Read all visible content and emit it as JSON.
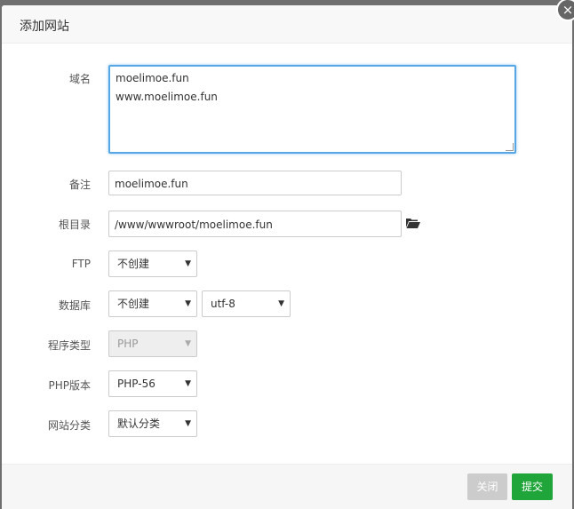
{
  "dialog": {
    "title": "添加网站",
    "close_symbol": "×"
  },
  "form": {
    "domain": {
      "label": "域名",
      "lines": [
        "moelimoe.fun",
        "www.moelimoe.fun"
      ]
    },
    "remark": {
      "label": "备注",
      "value": "moelimoe.fun"
    },
    "root_dir": {
      "label": "根目录",
      "value": "/www/wwwroot/moelimoe.fun",
      "icon": "folder-open-icon"
    },
    "ftp": {
      "label": "FTP",
      "selected": "不创建"
    },
    "database": {
      "label": "数据库",
      "selected": "不创建",
      "charset": "utf-8"
    },
    "program_type": {
      "label": "程序类型",
      "selected": "PHP",
      "disabled": true
    },
    "php_version": {
      "label": "PHP版本",
      "selected": "PHP-56"
    },
    "site_category": {
      "label": "网站分类",
      "selected": "默认分类"
    },
    "caret": "▼"
  },
  "footer": {
    "close_label": "关闭",
    "submit_label": "提交"
  },
  "colors": {
    "focus_border": "#55a7e6",
    "submit_bg": "#20a53a",
    "close_bg": "#cccccc"
  }
}
